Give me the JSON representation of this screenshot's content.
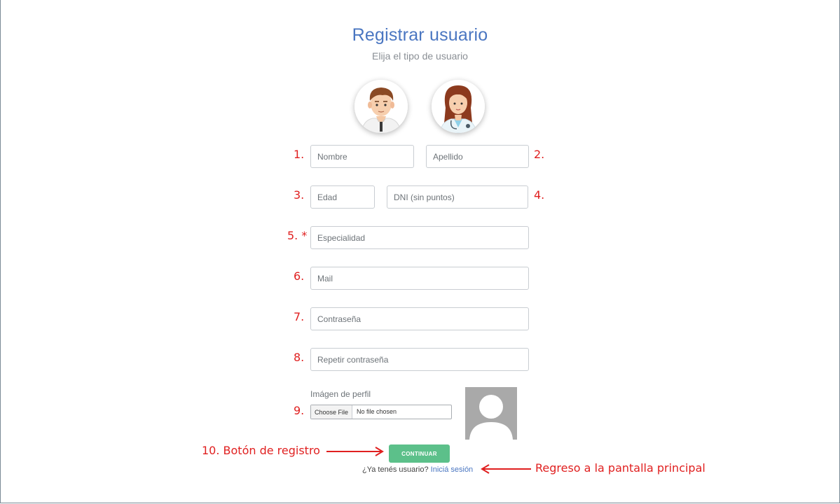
{
  "header": {
    "title": "Registrar usuario",
    "subtitle": "Elija el tipo de usuario"
  },
  "user_types": [
    {
      "icon": "patient-avatar-icon"
    },
    {
      "icon": "doctor-avatar-icon"
    }
  ],
  "form": {
    "nombre_placeholder": "Nombre",
    "apellido_placeholder": "Apellido",
    "edad_placeholder": "Edad",
    "dni_placeholder": "DNI (sin puntos)",
    "especialidad_placeholder": "Especialidad",
    "mail_placeholder": "Mail",
    "password_placeholder": "Contraseña",
    "repeat_password_placeholder": "Repetir contraseña",
    "profile_image_label": "Imágen de perfil",
    "file_button_label": "Choose File",
    "file_status": "No file chosen",
    "preview_icon": "default-profile-placeholder-icon",
    "submit_label": "CONTINUAR",
    "login_prompt": "¿Ya tenés usuario?",
    "login_link": "Iniciá sesión"
  },
  "annotations": {
    "n1": "1.",
    "n2": "2.",
    "n3": "3.",
    "n4": "4.",
    "n5": "5. *",
    "n6": "6.",
    "n7": "7.",
    "n8": "8.",
    "n9": "9.",
    "register_button_note": "10. Botón de registro",
    "return_note": "Regreso a la pantalla principal"
  },
  "colors": {
    "title": "#4a76c1",
    "annotation": "#e01f1f",
    "button": "#5cc08a",
    "link": "#4a76c1"
  }
}
